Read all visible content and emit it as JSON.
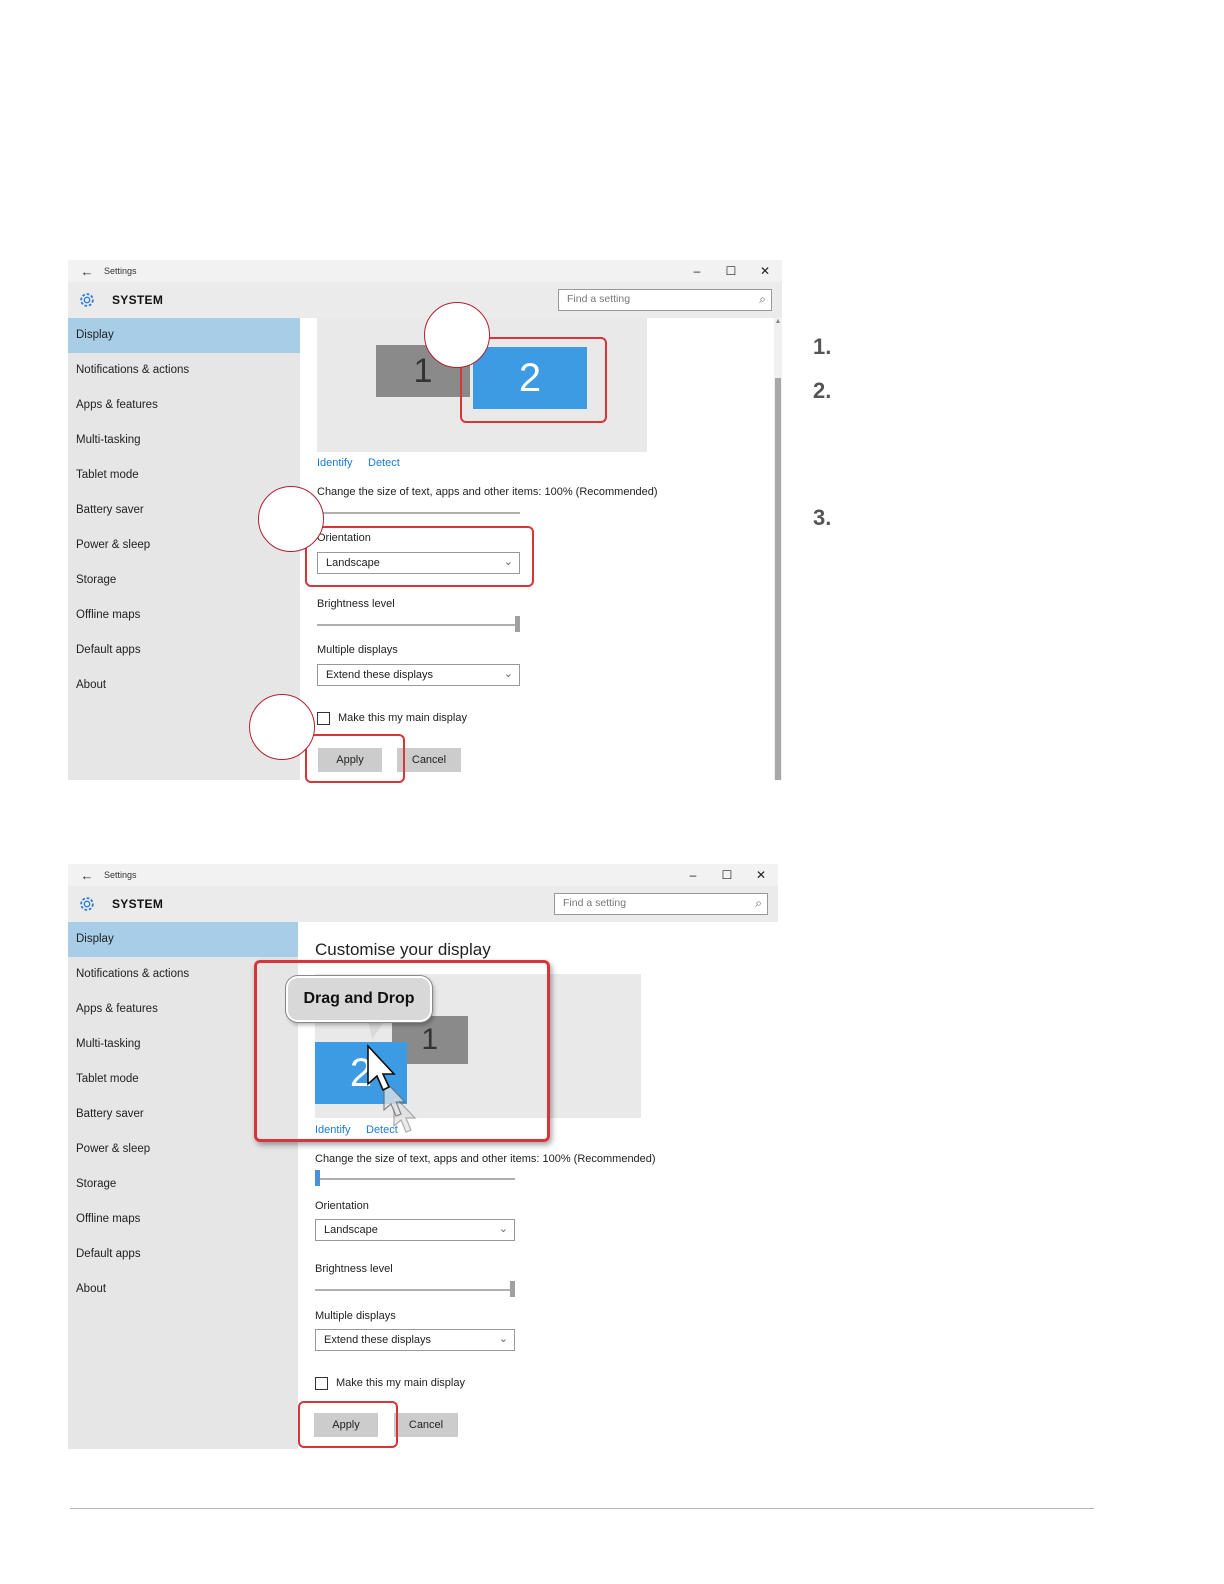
{
  "window": {
    "back_glyph": "←",
    "title": "Settings",
    "minimize": "–",
    "maximize": "☐",
    "close": "✕",
    "section": "SYSTEM",
    "search_placeholder": "Find a setting"
  },
  "sidebar": {
    "items": [
      {
        "label": "Display"
      },
      {
        "label": "Notifications & actions"
      },
      {
        "label": "Apps & features"
      },
      {
        "label": "Multi-tasking"
      },
      {
        "label": "Tablet mode"
      },
      {
        "label": "Battery saver"
      },
      {
        "label": "Power & sleep"
      },
      {
        "label": "Storage"
      },
      {
        "label": "Offline maps"
      },
      {
        "label": "Default apps"
      },
      {
        "label": "About"
      }
    ]
  },
  "display": {
    "page_title": "Customise your display",
    "monitor_1": "1",
    "monitor_2": "2",
    "identify": "Identify",
    "detect": "Detect",
    "scale_label": "Change the size of text, apps and other items: 100% (Recommended)",
    "orientation_label": "Orientation",
    "orientation_value": "Landscape",
    "brightness_label": "Brightness level",
    "multiple_label": "Multiple displays",
    "multiple_value": "Extend these displays",
    "main_display_label": "Make this my main display",
    "apply": "Apply",
    "cancel": "Cancel"
  },
  "annotation": {
    "bubble": "Drag and Drop"
  },
  "steps": [
    "1.",
    "2.",
    "3."
  ],
  "icons": {
    "gear": "gear-icon",
    "search": "search-icon",
    "chevron": "chevron-down-icon",
    "cursor": "mouse-cursor-icon"
  },
  "colors": {
    "highlight": "#d9343a",
    "accent_blue": "#3d9be3",
    "sidebar_active": "#a8cde6"
  }
}
